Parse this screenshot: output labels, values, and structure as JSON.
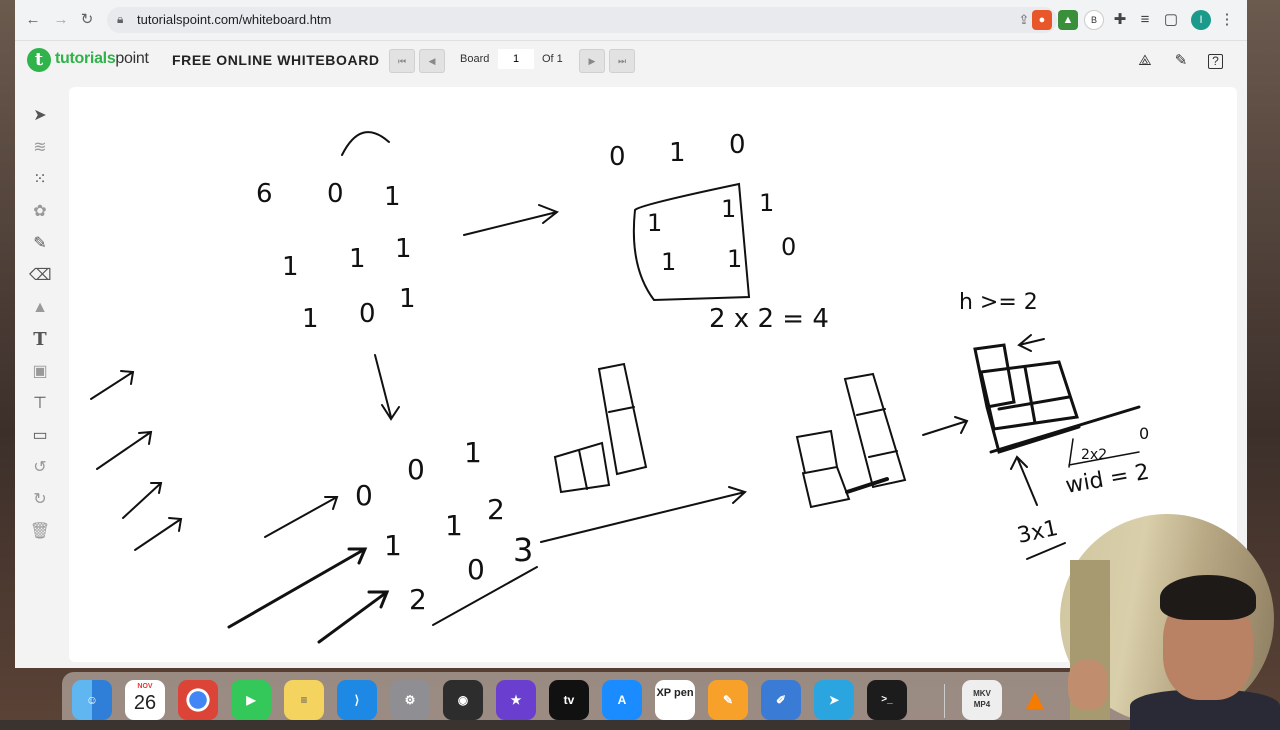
{
  "browser": {
    "url": "tutorialspoint.com/whiteboard.htm",
    "profile_initial": "I",
    "ext_badge": "B"
  },
  "app": {
    "logo_word_a": "tutorials",
    "logo_word_b": "point",
    "logo_glyph": "t",
    "title": "FREE ONLINE WHITEBOARD",
    "board_label": "Board",
    "board_value": "1",
    "of_label": "Of 1"
  },
  "toolbar_tools": [
    "select",
    "layers",
    "grid",
    "palette",
    "pencil",
    "eraser",
    "shapes",
    "text",
    "image",
    "presentation",
    "screen",
    "undo",
    "redo",
    "delete"
  ],
  "dock": {
    "calendar_month": "NOV",
    "calendar_day": "26",
    "xppen_label": "XP pen",
    "tv_label": "tv",
    "mkv_label": "MKV",
    "mp4_label": "MP4"
  },
  "whiteboard": {
    "top_left_grid": {
      "row1": [
        "6",
        "0",
        "1"
      ],
      "row2": [
        "1",
        "1",
        "1"
      ],
      "row3": [
        "1",
        "0",
        "1"
      ]
    },
    "top_mid_row": [
      "0",
      "1",
      "0"
    ],
    "square_cells": [
      "1",
      "1",
      "1",
      "1"
    ],
    "square_right": [
      "1",
      "0"
    ],
    "area_text": "2 x 2 = 4",
    "bottom_grid": {
      "row1": [
        "0",
        "0",
        "1"
      ],
      "row2": [
        "1",
        "1",
        "2"
      ],
      "row3": [
        "2",
        "0",
        "3"
      ]
    },
    "h_text": "h >= 2",
    "frac_text": "2x2",
    "wid_text": "wid = 2",
    "zero_text": "0",
    "dim_text": "3x1"
  },
  "colors": {
    "brand_green": "#2fb34a",
    "ink": "#111111"
  }
}
